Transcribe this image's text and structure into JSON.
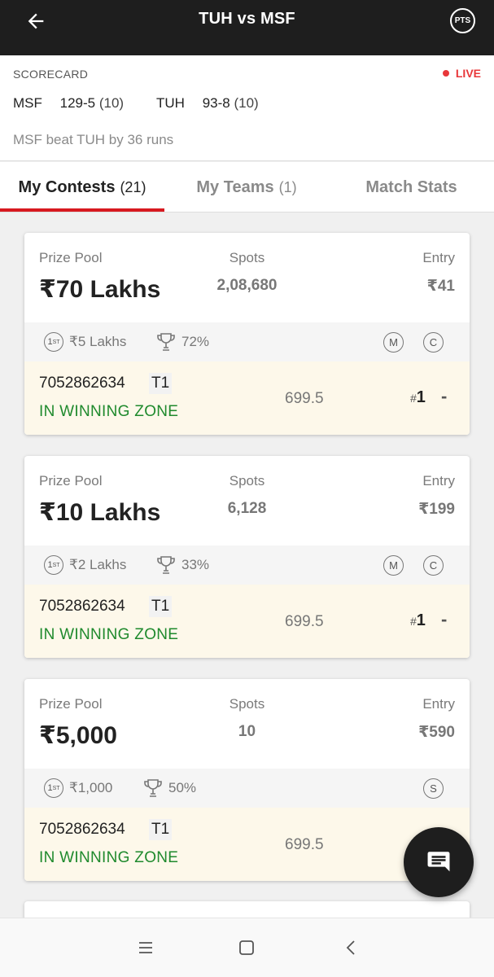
{
  "header": {
    "title": "TUH vs MSF",
    "pts_label": "PTS"
  },
  "scorecard": {
    "label": "SCORECARD",
    "live": "LIVE",
    "teams": [
      {
        "name": "MSF",
        "score": "129-5",
        "overs": "(10)"
      },
      {
        "name": "TUH",
        "score": "93-8",
        "overs": "(10)"
      }
    ],
    "result": "MSF beat TUH by 36 runs"
  },
  "tabs": [
    {
      "label": "My Contests",
      "count": "(21)",
      "active": true
    },
    {
      "label": "My Teams",
      "count": "(1)",
      "active": false
    },
    {
      "label": "Match Stats",
      "count": "",
      "active": false
    }
  ],
  "labels": {
    "prize_pool": "Prize Pool",
    "spots": "Spots",
    "entry": "Entry",
    "first_prefix": "1",
    "first_suffix": "ST"
  },
  "contests": [
    {
      "prize": "₹70 Lakhs",
      "spots": "2,08,680",
      "entry": "₹41",
      "first_prize": "₹5 Lakhs",
      "winners_pct": "72%",
      "badges": [
        "M",
        "C"
      ],
      "team_id": "7052862634",
      "team_tag": "T1",
      "zone": "IN WINNING ZONE",
      "points": "699.5",
      "rank_hash": "#",
      "rank": "1",
      "change": "-"
    },
    {
      "prize": "₹10 Lakhs",
      "spots": "6,128",
      "entry": "₹199",
      "first_prize": "₹2 Lakhs",
      "winners_pct": "33%",
      "badges": [
        "M",
        "C"
      ],
      "team_id": "7052862634",
      "team_tag": "T1",
      "zone": "IN WINNING ZONE",
      "points": "699.5",
      "rank_hash": "#",
      "rank": "1",
      "change": "-"
    },
    {
      "prize": "₹5,000",
      "spots": "10",
      "entry": "₹590",
      "first_prize": "₹1,000",
      "winners_pct": "50%",
      "badges": [
        "S"
      ],
      "team_id": "7052862634",
      "team_tag": "T1",
      "zone": "IN WINNING ZONE",
      "points": "699.5",
      "rank_hash": "",
      "rank": "",
      "change": ""
    }
  ],
  "icons": {
    "back": "arrow-left-icon",
    "chat": "chat-icon",
    "trophy": "trophy-icon"
  },
  "colors": {
    "live": "#e8373a",
    "active_tab": "#d71920",
    "winning": "#1f8a2d",
    "topbar": "#1e1e1e"
  }
}
